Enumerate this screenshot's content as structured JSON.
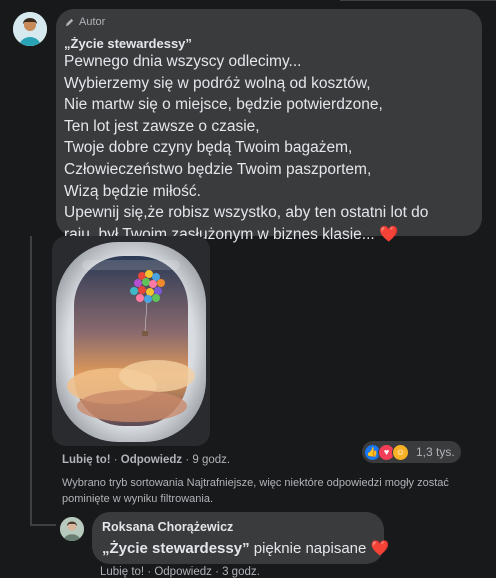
{
  "post": {
    "author_badge": "Autor",
    "title": "„Życie stewardessy”",
    "lines": [
      "Pewnego dnia wszyscy odlecimy...",
      "Wybierzemy się w podróż wolną od kosztów,",
      "Nie martw się o miejsce, będzie potwierdzone,",
      "Ten lot jest zawsze o czasie,",
      "Twoje dobre czyny będą Twoim bagażem,",
      "Człowieczeństwo będzie Twoim paszportem,",
      "Wizą będzie miłość.",
      "Upewnij się,że robisz wszystko, aby ten ostatni lot do",
      "raju, był Twoim zasłużonym w biznes klasie..."
    ],
    "heart": "❤️",
    "actions": {
      "like": "Lubię to!",
      "sep1": " · ",
      "reply": "Odpowiedz",
      "sep2": " · ",
      "time": "9 godz."
    },
    "reactions": {
      "count": "1,3 tys.",
      "icons": [
        "like-icon",
        "love-icon",
        "care-icon"
      ]
    },
    "sort_note": "Wybrano tryb sortowania Najtrafniejsze, więc niektóre odpowiedzi mogły zostać pominięte w wyniku filtrowania."
  },
  "reply": {
    "name": "Roksana Chorążewicz",
    "quote": "„Życie stewardessy”",
    "text": " pięknie napisane ",
    "heart": "❤️",
    "actions_partial": "Lubię to! · Odpowiedz · 3 godz."
  },
  "colors": {
    "background": "#18191a",
    "bubble": "#3a3b3c",
    "text": "#e4e6eb",
    "muted": "#b0b3b8",
    "heart": "#f02849",
    "like": "#1877f2"
  }
}
